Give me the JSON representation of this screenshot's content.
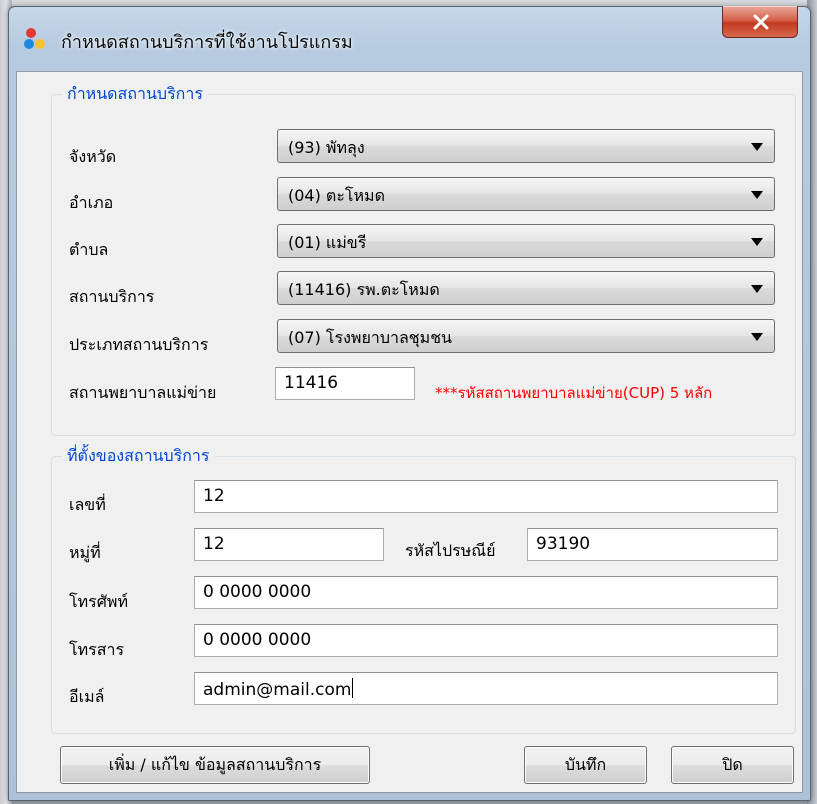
{
  "window": {
    "title": "กำหนดสถานบริการที่ใช้งานโปรแกรม"
  },
  "service_group": {
    "legend": "กำหนดสถานบริการ",
    "province_label": "จังหวัด",
    "province_value": "(93) พัทลุง",
    "district_label": "อำเภอ",
    "district_value": "(04) ตะโหมด",
    "subdistrict_label": "ตำบล",
    "subdistrict_value": "(01) แม่ขรี",
    "facility_label": "สถานบริการ",
    "facility_value": "(11416) รพ.ตะโหมด",
    "facility_type_label": "ประเภทสถานบริการ",
    "facility_type_value": "(07) โรงพยาบาลชุมชน",
    "main_hospital_label": "สถานพยาบาลแม่ข่าย",
    "main_hospital_value": "11416",
    "main_hospital_note": "***รหัสสถานพยาบาลแม่ข่าย(CUP) 5 หลัก"
  },
  "location_group": {
    "legend": "ที่ตั้งของสถานบริการ",
    "house_no_label": "เลขที่",
    "house_no_value": "12",
    "moo_label": "หมู่ที่",
    "moo_value": "12",
    "postcode_label": "รหัสไปรษณีย์",
    "postcode_value": "93190",
    "phone_label": "โทรศัพท์",
    "phone_value": "0 0000 0000",
    "fax_label": "โทรสาร",
    "fax_value": "0 0000 0000",
    "email_label": "อีเมล์",
    "email_value": "admin@mail.com"
  },
  "buttons": {
    "edit_facility": "เพิ่ม / แก้ไข ข้อมูลสถานบริการ",
    "save": "บันทึก",
    "close": "ปิด"
  },
  "colors": {
    "legend": "#0046d5",
    "note": "#ff0000",
    "close_button": "#c23a20"
  },
  "icons": {
    "app": "colored-dots-icon",
    "close": "x-icon"
  }
}
